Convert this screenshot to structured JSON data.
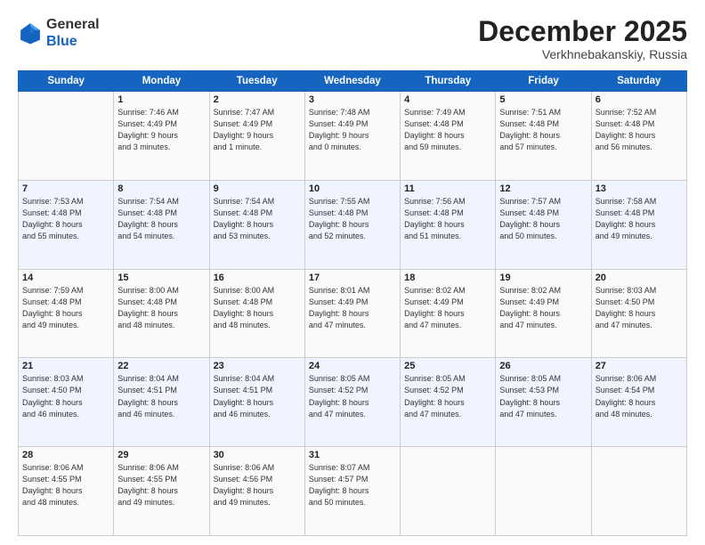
{
  "header": {
    "logo_general": "General",
    "logo_blue": "Blue",
    "month_title": "December 2025",
    "subtitle": "Verkhnebakanskiy, Russia"
  },
  "days_of_week": [
    "Sunday",
    "Monday",
    "Tuesday",
    "Wednesday",
    "Thursday",
    "Friday",
    "Saturday"
  ],
  "weeks": [
    [
      {
        "day": "",
        "info": ""
      },
      {
        "day": "1",
        "info": "Sunrise: 7:46 AM\nSunset: 4:49 PM\nDaylight: 9 hours\nand 3 minutes."
      },
      {
        "day": "2",
        "info": "Sunrise: 7:47 AM\nSunset: 4:49 PM\nDaylight: 9 hours\nand 1 minute."
      },
      {
        "day": "3",
        "info": "Sunrise: 7:48 AM\nSunset: 4:49 PM\nDaylight: 9 hours\nand 0 minutes."
      },
      {
        "day": "4",
        "info": "Sunrise: 7:49 AM\nSunset: 4:48 PM\nDaylight: 8 hours\nand 59 minutes."
      },
      {
        "day": "5",
        "info": "Sunrise: 7:51 AM\nSunset: 4:48 PM\nDaylight: 8 hours\nand 57 minutes."
      },
      {
        "day": "6",
        "info": "Sunrise: 7:52 AM\nSunset: 4:48 PM\nDaylight: 8 hours\nand 56 minutes."
      }
    ],
    [
      {
        "day": "7",
        "info": "Sunrise: 7:53 AM\nSunset: 4:48 PM\nDaylight: 8 hours\nand 55 minutes."
      },
      {
        "day": "8",
        "info": "Sunrise: 7:54 AM\nSunset: 4:48 PM\nDaylight: 8 hours\nand 54 minutes."
      },
      {
        "day": "9",
        "info": "Sunrise: 7:54 AM\nSunset: 4:48 PM\nDaylight: 8 hours\nand 53 minutes."
      },
      {
        "day": "10",
        "info": "Sunrise: 7:55 AM\nSunset: 4:48 PM\nDaylight: 8 hours\nand 52 minutes."
      },
      {
        "day": "11",
        "info": "Sunrise: 7:56 AM\nSunset: 4:48 PM\nDaylight: 8 hours\nand 51 minutes."
      },
      {
        "day": "12",
        "info": "Sunrise: 7:57 AM\nSunset: 4:48 PM\nDaylight: 8 hours\nand 50 minutes."
      },
      {
        "day": "13",
        "info": "Sunrise: 7:58 AM\nSunset: 4:48 PM\nDaylight: 8 hours\nand 49 minutes."
      }
    ],
    [
      {
        "day": "14",
        "info": "Sunrise: 7:59 AM\nSunset: 4:48 PM\nDaylight: 8 hours\nand 49 minutes."
      },
      {
        "day": "15",
        "info": "Sunrise: 8:00 AM\nSunset: 4:48 PM\nDaylight: 8 hours\nand 48 minutes."
      },
      {
        "day": "16",
        "info": "Sunrise: 8:00 AM\nSunset: 4:48 PM\nDaylight: 8 hours\nand 48 minutes."
      },
      {
        "day": "17",
        "info": "Sunrise: 8:01 AM\nSunset: 4:49 PM\nDaylight: 8 hours\nand 47 minutes."
      },
      {
        "day": "18",
        "info": "Sunrise: 8:02 AM\nSunset: 4:49 PM\nDaylight: 8 hours\nand 47 minutes."
      },
      {
        "day": "19",
        "info": "Sunrise: 8:02 AM\nSunset: 4:49 PM\nDaylight: 8 hours\nand 47 minutes."
      },
      {
        "day": "20",
        "info": "Sunrise: 8:03 AM\nSunset: 4:50 PM\nDaylight: 8 hours\nand 47 minutes."
      }
    ],
    [
      {
        "day": "21",
        "info": "Sunrise: 8:03 AM\nSunset: 4:50 PM\nDaylight: 8 hours\nand 46 minutes."
      },
      {
        "day": "22",
        "info": "Sunrise: 8:04 AM\nSunset: 4:51 PM\nDaylight: 8 hours\nand 46 minutes."
      },
      {
        "day": "23",
        "info": "Sunrise: 8:04 AM\nSunset: 4:51 PM\nDaylight: 8 hours\nand 46 minutes."
      },
      {
        "day": "24",
        "info": "Sunrise: 8:05 AM\nSunset: 4:52 PM\nDaylight: 8 hours\nand 47 minutes."
      },
      {
        "day": "25",
        "info": "Sunrise: 8:05 AM\nSunset: 4:52 PM\nDaylight: 8 hours\nand 47 minutes."
      },
      {
        "day": "26",
        "info": "Sunrise: 8:05 AM\nSunset: 4:53 PM\nDaylight: 8 hours\nand 47 minutes."
      },
      {
        "day": "27",
        "info": "Sunrise: 8:06 AM\nSunset: 4:54 PM\nDaylight: 8 hours\nand 48 minutes."
      }
    ],
    [
      {
        "day": "28",
        "info": "Sunrise: 8:06 AM\nSunset: 4:55 PM\nDaylight: 8 hours\nand 48 minutes."
      },
      {
        "day": "29",
        "info": "Sunrise: 8:06 AM\nSunset: 4:55 PM\nDaylight: 8 hours\nand 49 minutes."
      },
      {
        "day": "30",
        "info": "Sunrise: 8:06 AM\nSunset: 4:56 PM\nDaylight: 8 hours\nand 49 minutes."
      },
      {
        "day": "31",
        "info": "Sunrise: 8:07 AM\nSunset: 4:57 PM\nDaylight: 8 hours\nand 50 minutes."
      },
      {
        "day": "",
        "info": ""
      },
      {
        "day": "",
        "info": ""
      },
      {
        "day": "",
        "info": ""
      }
    ]
  ]
}
